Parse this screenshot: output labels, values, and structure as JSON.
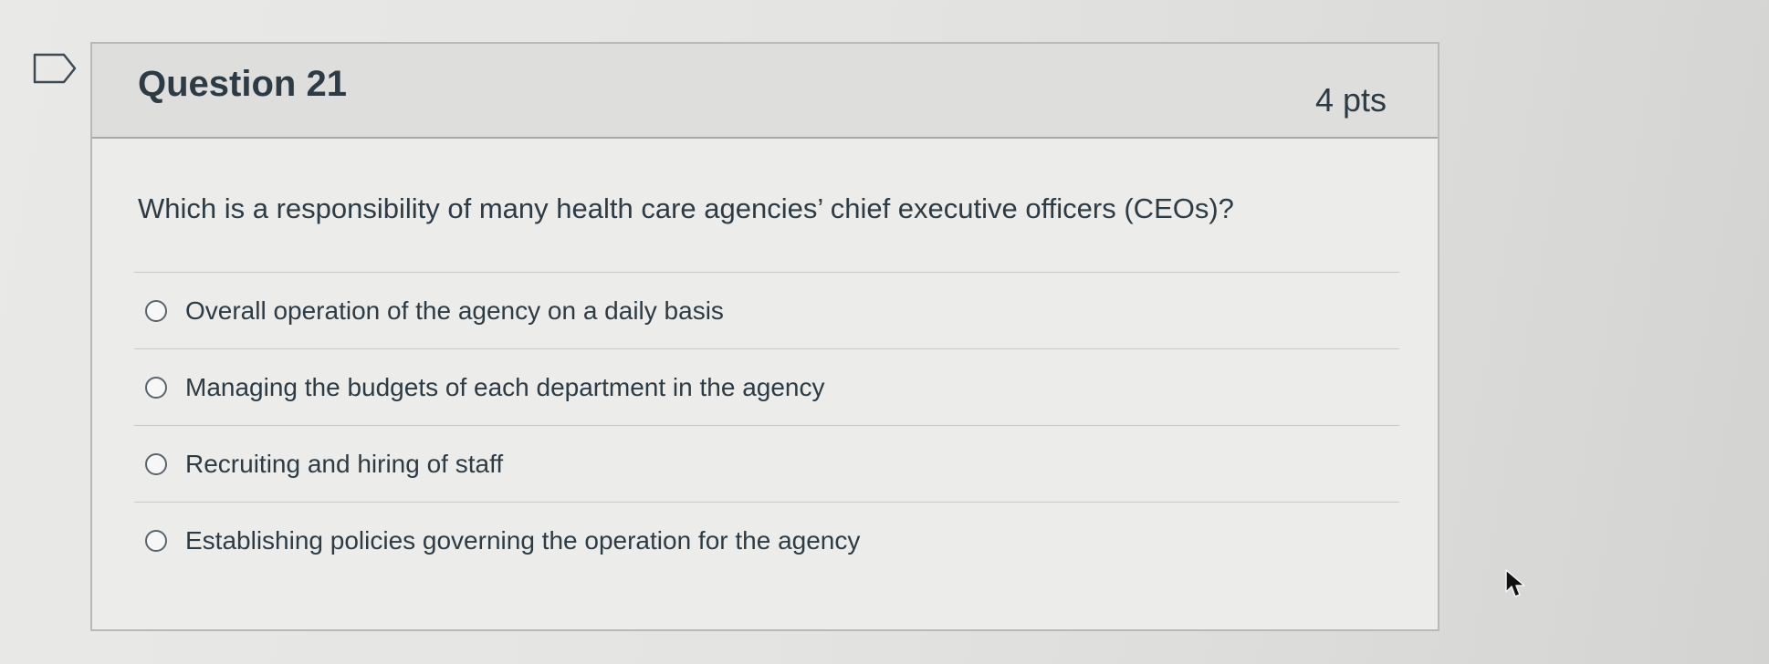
{
  "question": {
    "title": "Question 21",
    "points": "4 pts",
    "prompt": "Which is a responsibility of many health care agencies’ chief executive officers (CEOs)?",
    "answers": [
      {
        "label": "Overall operation of the agency on a daily basis",
        "selected": false
      },
      {
        "label": "Managing the budgets of each department in the agency",
        "selected": false
      },
      {
        "label": "Recruiting and hiring of staff",
        "selected": false
      },
      {
        "label": "Establishing policies governing the operation for the agency",
        "selected": false
      }
    ]
  },
  "icons": {
    "flag": "flag-question-icon",
    "radio": "radio-button-icon",
    "cursor": "mouse-pointer-icon"
  },
  "colors": {
    "text": "#2d3b45",
    "header_background": "#dededd",
    "card_background": "#ececeb",
    "border": "#b9b9b9"
  }
}
